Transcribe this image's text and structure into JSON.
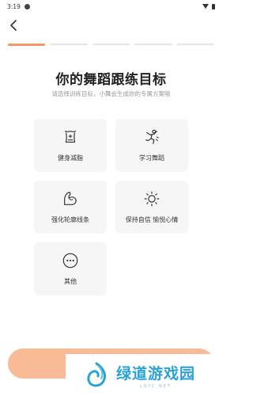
{
  "status_bar": {
    "time": "3:19"
  },
  "progress": {
    "total_steps": 5,
    "current_step": 1
  },
  "header": {
    "title": "你的舞蹈跟练目标",
    "subtitle": "请选择训练目标，小舞会生成你的专属方案哦"
  },
  "goals": [
    {
      "label": "健身减脂",
      "icon": "body-scale-icon"
    },
    {
      "label": "学习舞蹈",
      "icon": "dancer-icon"
    },
    {
      "label": "强化轮廓线条",
      "icon": "flexed-arm-icon"
    },
    {
      "label": "保持自信 愉悦心情",
      "icon": "sun-icon"
    },
    {
      "label": "其他",
      "icon": "more-dots-icon"
    }
  ],
  "watermark": {
    "title": "绿道游戏园",
    "subtitle": "LDYC.NET"
  },
  "colors": {
    "accent": "#f49867",
    "button": "#f8b38b",
    "card": "#f6f6f6",
    "watermark": "#2aa2d8"
  }
}
